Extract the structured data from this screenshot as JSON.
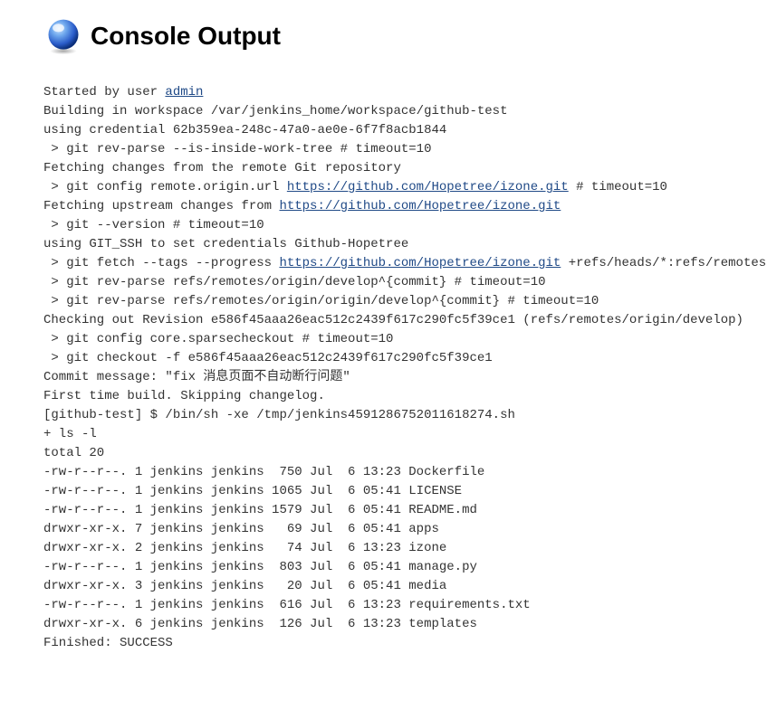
{
  "header": {
    "title": "Console Output"
  },
  "console": {
    "lines": [
      {
        "pre": "Started by user ",
        "link": "admin",
        "linkUrl": "#",
        "post": ""
      },
      {
        "pre": "Building in workspace /var/jenkins_home/workspace/github-test"
      },
      {
        "pre": "using credential 62b359ea-248c-47a0-ae0e-6f7f8acb1844"
      },
      {
        "pre": " > git rev-parse --is-inside-work-tree # timeout=10"
      },
      {
        "pre": "Fetching changes from the remote Git repository"
      },
      {
        "pre": " > git config remote.origin.url ",
        "link": "https://github.com/Hopetree/izone.git",
        "linkUrl": "#",
        "post": " # timeout=10"
      },
      {
        "pre": "Fetching upstream changes from ",
        "link": "https://github.com/Hopetree/izone.git",
        "linkUrl": "#",
        "post": ""
      },
      {
        "pre": " > git --version # timeout=10"
      },
      {
        "pre": "using GIT_SSH to set credentials Github-Hopetree"
      },
      {
        "pre": " > git fetch --tags --progress ",
        "link": "https://github.com/Hopetree/izone.git",
        "linkUrl": "#",
        "post": " +refs/heads/*:refs/remotes/ori"
      },
      {
        "pre": " > git rev-parse refs/remotes/origin/develop^{commit} # timeout=10"
      },
      {
        "pre": " > git rev-parse refs/remotes/origin/origin/develop^{commit} # timeout=10"
      },
      {
        "pre": "Checking out Revision e586f45aaa26eac512c2439f617c290fc5f39ce1 (refs/remotes/origin/develop)"
      },
      {
        "pre": " > git config core.sparsecheckout # timeout=10"
      },
      {
        "pre": " > git checkout -f e586f45aaa26eac512c2439f617c290fc5f39ce1"
      },
      {
        "pre": "Commit message: \"fix 消息页面不自动断行问题\""
      },
      {
        "pre": "First time build. Skipping changelog."
      },
      {
        "pre": "[github-test] $ /bin/sh -xe /tmp/jenkins4591286752011618274.sh"
      },
      {
        "pre": "+ ls -l"
      },
      {
        "pre": "total 20"
      },
      {
        "pre": "-rw-r--r--. 1 jenkins jenkins  750 Jul  6 13:23 Dockerfile"
      },
      {
        "pre": "-rw-r--r--. 1 jenkins jenkins 1065 Jul  6 05:41 LICENSE"
      },
      {
        "pre": "-rw-r--r--. 1 jenkins jenkins 1579 Jul  6 05:41 README.md"
      },
      {
        "pre": "drwxr-xr-x. 7 jenkins jenkins   69 Jul  6 05:41 apps"
      },
      {
        "pre": "drwxr-xr-x. 2 jenkins jenkins   74 Jul  6 13:23 izone"
      },
      {
        "pre": "-rw-r--r--. 1 jenkins jenkins  803 Jul  6 05:41 manage.py"
      },
      {
        "pre": "drwxr-xr-x. 3 jenkins jenkins   20 Jul  6 05:41 media"
      },
      {
        "pre": "-rw-r--r--. 1 jenkins jenkins  616 Jul  6 13:23 requirements.txt"
      },
      {
        "pre": "drwxr-xr-x. 6 jenkins jenkins  126 Jul  6 13:23 templates"
      },
      {
        "pre": "Finished: SUCCESS"
      }
    ]
  }
}
